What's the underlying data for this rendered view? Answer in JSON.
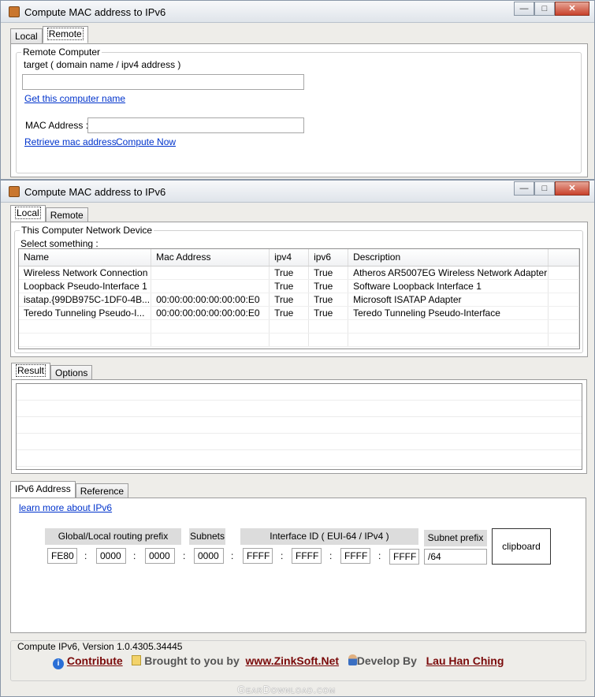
{
  "remote_window": {
    "title": "Compute MAC address to IPv6",
    "tabs": [
      "Local",
      "Remote"
    ],
    "groupbox_title": "Remote Computer",
    "target_label": "target ( domain name / ipv4 address )",
    "target_value": "",
    "get_name_link": "Get this computer name",
    "mac_label": "MAC Address :",
    "mac_value": "",
    "retrieve_link": "Retrieve mac address",
    "compute_link": "Compute Now"
  },
  "main_window": {
    "title": "Compute MAC address to IPv6",
    "tabs": [
      "Local",
      "Remote"
    ],
    "device_group_title": "This Computer Network Device",
    "select_label": "Select something :",
    "columns": [
      "Name",
      "Mac Address",
      "ipv4",
      "ipv6",
      "Description"
    ],
    "rows": [
      {
        "name": "Wireless Network Connection",
        "mac": "",
        "ipv4": "True",
        "ipv6": "True",
        "desc": "Atheros AR5007EG Wireless Network Adapter"
      },
      {
        "name": "Loopback Pseudo-Interface 1",
        "mac": "",
        "ipv4": "True",
        "ipv6": "True",
        "desc": "Software Loopback Interface 1"
      },
      {
        "name": "isatap.{99DB975C-1DF0-4B...",
        "mac": "00:00:00:00:00:00:00:E0",
        "ipv4": "True",
        "ipv6": "True",
        "desc": "Microsoft ISATAP Adapter"
      },
      {
        "name": "Teredo Tunneling Pseudo-I...",
        "mac": "00:00:00:00:00:00:00:E0",
        "ipv4": "True",
        "ipv6": "True",
        "desc": "Teredo Tunneling Pseudo-Interface"
      }
    ],
    "result_tabs": [
      "Result",
      "Options"
    ],
    "ipv6_tabs": [
      "IPv6 Address",
      "Reference"
    ],
    "learn_link": "learn more about IPv6",
    "headers": {
      "prefix": "Global/Local routing prefix",
      "subnets": "Subnets",
      "interface": "Interface ID ( EUI-64 / IPv4 )",
      "subnet_prefix": "Subnet prefix"
    },
    "fields": {
      "p1": "FE80",
      "p2": "0000",
      "p3": "0000",
      "subnet": "0000",
      "i1": "FFFF",
      "i2": "FFFF",
      "i3": "FFFF",
      "i4": "FFFF",
      "subnet_prefix": "/64"
    },
    "clipboard_label": "clipboard",
    "version": "Compute IPv6, Version 1.0.4305.34445",
    "contribute": "Contribute",
    "brought_by": "Brought to you by",
    "site": "www.ZinkSoft.Net",
    "develop_by": "Develop By",
    "author": "Lau Han Ching"
  },
  "watermark": "GearDownload.com"
}
